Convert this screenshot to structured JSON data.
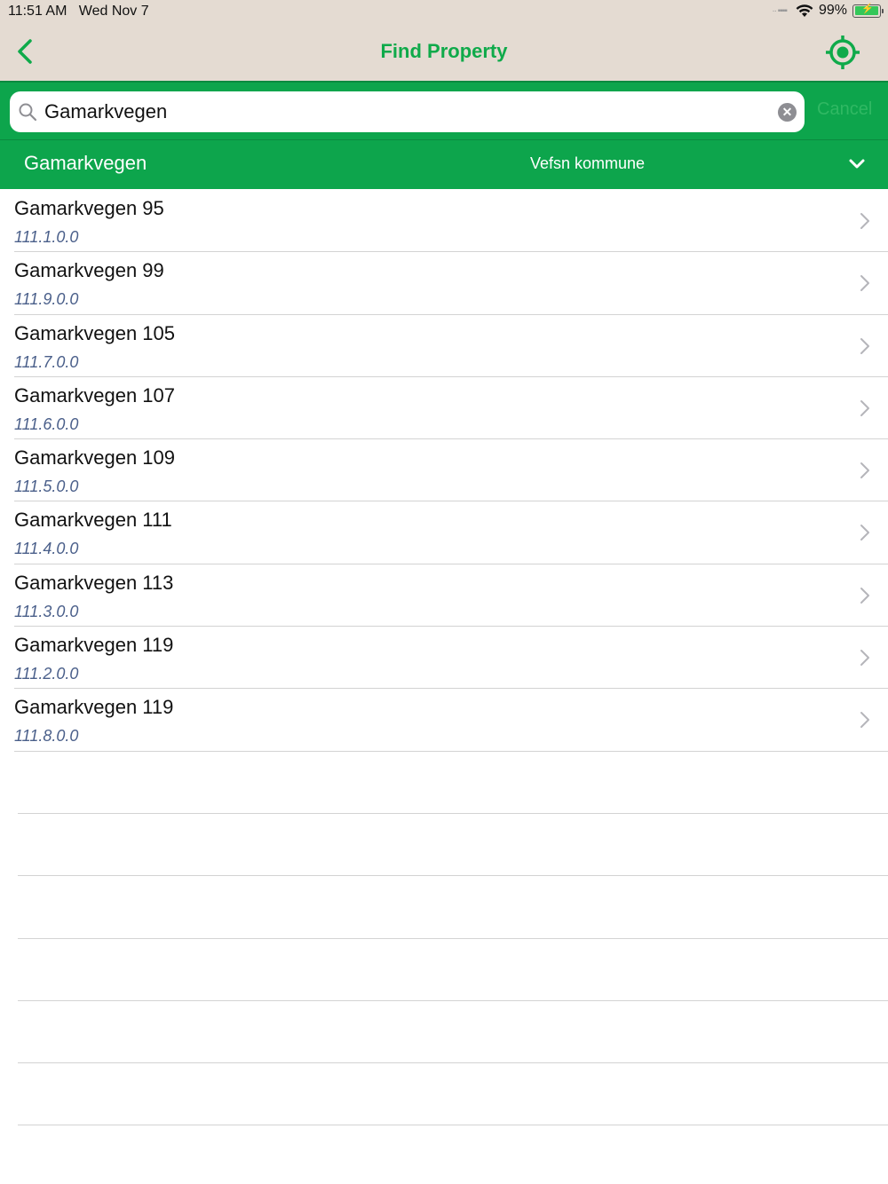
{
  "status": {
    "time": "11:51 AM",
    "date": "Wed Nov 7",
    "battery": "99%",
    "battery_level": 0.99
  },
  "nav": {
    "title": "Find Property",
    "back_icon": "chevron-left-icon",
    "locate_icon": "location-target-icon"
  },
  "search": {
    "value": "Gamarkvegen",
    "placeholder": "",
    "cancel_label": "Cancel"
  },
  "filter": {
    "street": "Gamarkvegen",
    "municipality": "Vefsn kommune"
  },
  "results": [
    {
      "title": "Gamarkvegen 95",
      "id": "111.1.0.0"
    },
    {
      "title": "Gamarkvegen 99",
      "id": "111.9.0.0"
    },
    {
      "title": "Gamarkvegen 105",
      "id": "111.7.0.0"
    },
    {
      "title": "Gamarkvegen 107",
      "id": "111.6.0.0"
    },
    {
      "title": "Gamarkvegen 109",
      "id": "111.5.0.0"
    },
    {
      "title": "Gamarkvegen 111",
      "id": "111.4.0.0"
    },
    {
      "title": "Gamarkvegen 113",
      "id": "111.3.0.0"
    },
    {
      "title": "Gamarkvegen 119",
      "id": "111.2.0.0"
    },
    {
      "title": "Gamarkvegen 119",
      "id": "111.8.0.0"
    }
  ],
  "colors": {
    "accent_green": "#0da54c",
    "title_green": "#0faa4a",
    "header_bg": "#e4dbd2",
    "subtitle_blue": "#4a5f8a"
  }
}
